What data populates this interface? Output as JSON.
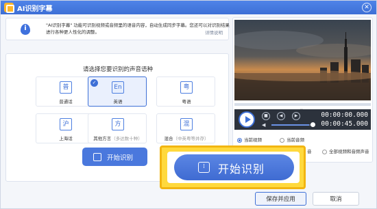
{
  "window": {
    "title": "AI识别字幕",
    "close_label": "✕"
  },
  "info": {
    "text": "\"AI识别字幕\" 功能可识别视频或音频里的语音内容，自动生成同步字幕。您还可以对识别结果进行各种更人性化的调整。",
    "link": "详情说明",
    "icon_glyph": "i"
  },
  "language": {
    "heading": "请选择您要识别的声音语种",
    "options": [
      {
        "glyph": "普",
        "label": "普通话",
        "sub": "",
        "selected": false
      },
      {
        "glyph": "En",
        "label": "英语",
        "sub": "",
        "selected": true
      },
      {
        "glyph": "粤",
        "label": "粤语",
        "sub": "",
        "selected": false
      },
      {
        "glyph": "沪",
        "label": "上海话",
        "sub": "",
        "selected": false
      },
      {
        "glyph": "方",
        "label": "其他方言",
        "sub": "（多达数十种）",
        "selected": false
      },
      {
        "glyph": "混",
        "label": "混合",
        "sub": "（中英粤等并存）",
        "selected": false
      }
    ],
    "check_mark": "✓"
  },
  "start_button_label": "开始识别",
  "player": {
    "progress_fraction": 0.0,
    "volume_fraction": 0.95,
    "current_time": "00:00:00.000",
    "total_time": "00:00:45.000",
    "stop_glyph": "■",
    "prev_glyph": "◀",
    "next_glyph": "▶",
    "volume_glyph": "◀",
    "chevron_glyph": "⌄"
  },
  "source_options": [
    {
      "label": "当前视频",
      "checked": true
    },
    {
      "label": "当前音频",
      "checked": false
    },
    {
      "label": "音",
      "checked": false
    },
    {
      "label": "全部视频和音频声音",
      "checked": false
    }
  ],
  "highlight": {
    "button_label": "开始识别",
    "icon_glyph": "⁞"
  },
  "footer": {
    "save_label": "保存并应用",
    "cancel_label": "取消"
  },
  "colors": {
    "accent": "#3d6fd6",
    "highlight": "#ffd93d"
  }
}
